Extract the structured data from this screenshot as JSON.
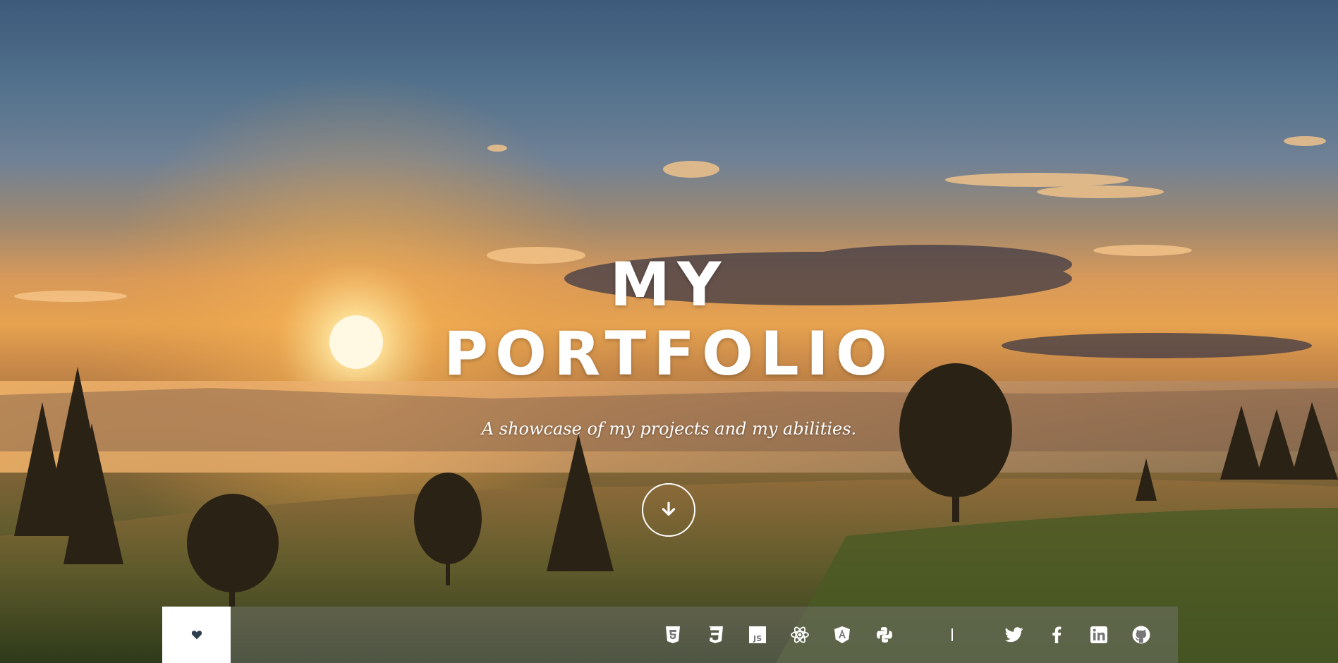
{
  "hero": {
    "title_line1": "MY",
    "title_line2": "PORTFOLIO",
    "subtitle": "A showcase of my projects and my abilities."
  },
  "scroll_button": {
    "icon": "arrow-down-icon"
  },
  "footer": {
    "heart_icon": "heart-icon",
    "tech_icons": [
      "html5-icon",
      "css3-icon",
      "javascript-icon",
      "react-icon",
      "angular-icon",
      "python-icon"
    ],
    "social_icons": [
      "twitter-icon",
      "facebook-icon",
      "linkedin-icon",
      "github-icon"
    ]
  },
  "colors": {
    "text": "#ffffff",
    "footer_bg": "rgba(120,120,120,0.45)",
    "heart_box_bg": "#ffffff",
    "heart_color": "#2c3e50"
  }
}
